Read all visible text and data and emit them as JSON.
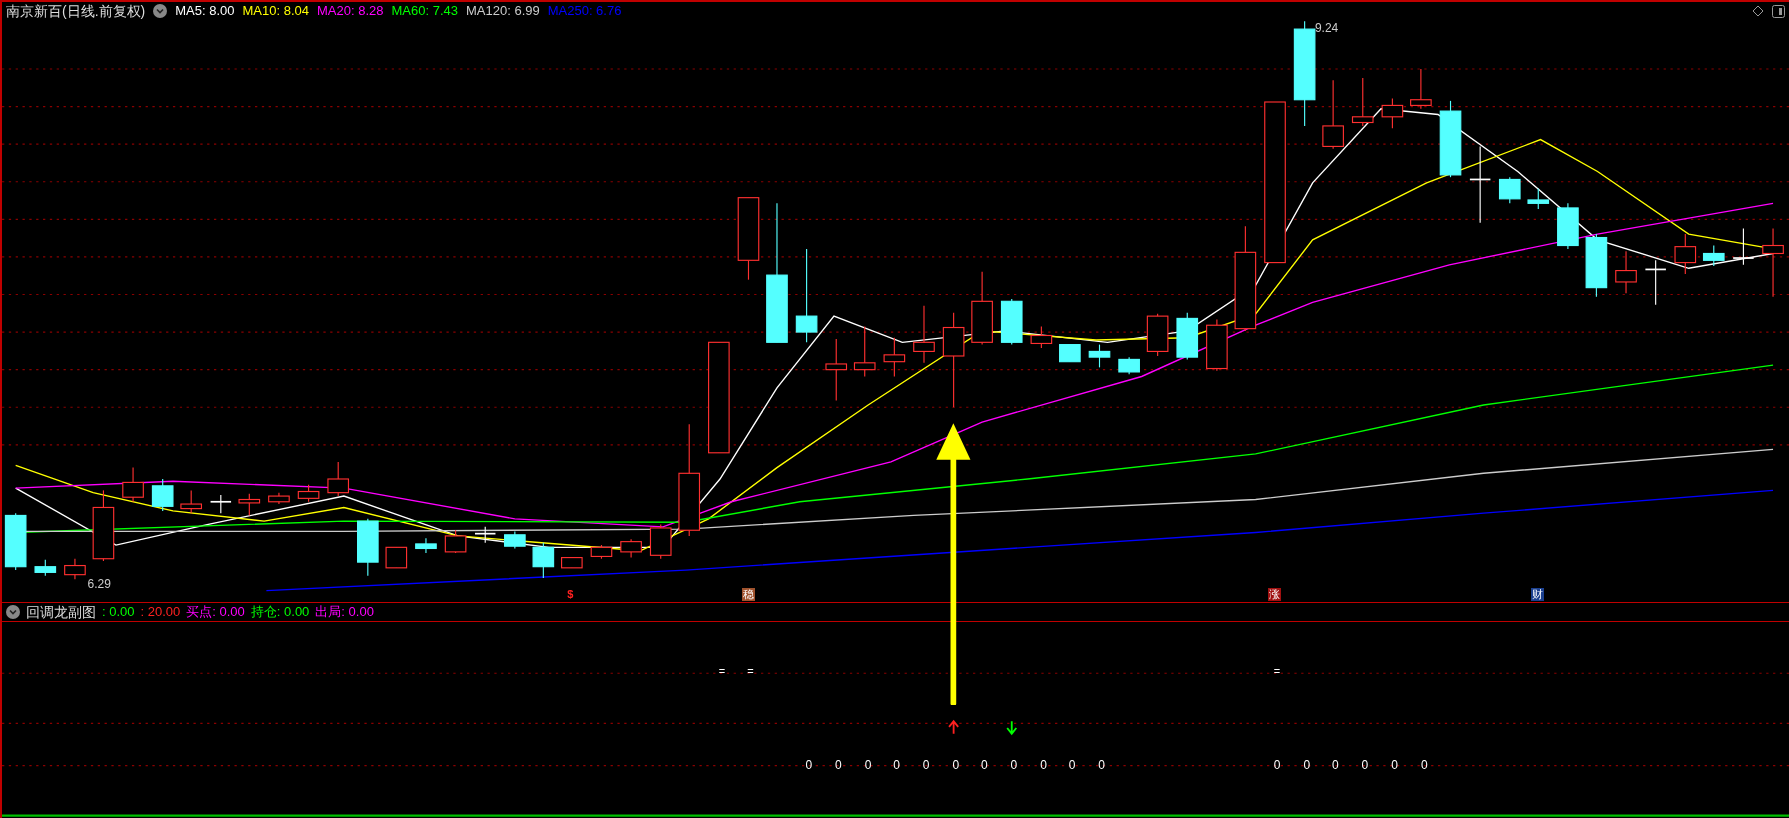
{
  "header": {
    "title": "南京新百(日线.前复权)",
    "indicators": [
      {
        "label": "MA5: 8.00",
        "color": "#ffffff"
      },
      {
        "label": "MA10: 8.04",
        "color": "#ffff00"
      },
      {
        "label": "MA20: 8.28",
        "color": "#ff00ff"
      },
      {
        "label": "MA60: 7.43",
        "color": "#00ff00"
      },
      {
        "label": "MA120: 6.99",
        "color": "#cccccc"
      },
      {
        "label": "MA250: 6.76",
        "color": "#0000ff"
      }
    ]
  },
  "main_chart": {
    "high_label": "9.24",
    "low_label": "6.29",
    "signals": [
      {
        "text": "$",
        "kind": "text",
        "color": "#ff2020"
      },
      {
        "text": "稳",
        "kind": "badge",
        "color": "#a0522d"
      },
      {
        "text": "涨",
        "kind": "badge",
        "color": "#a01010"
      },
      {
        "text": "财",
        "kind": "badge",
        "color": "#1a3f8f"
      }
    ]
  },
  "sub_chart": {
    "title": "回调龙副图",
    "values": [
      {
        "label": ": 0.00",
        "color": "#00ff00"
      },
      {
        "label": ": 20.00",
        "color": "#ff2020"
      },
      {
        "label": "买点: 0.00",
        "color": "#ff00ff"
      },
      {
        "label": "持仓: 0.00",
        "color": "#00ff00"
      },
      {
        "label": "出局: 0.00",
        "color": "#ff00ff"
      }
    ],
    "equals_marks": [
      "=",
      "=",
      "="
    ],
    "zeros": [
      "0",
      "0",
      "0",
      "0",
      "0",
      "0",
      "0",
      "0",
      "0",
      "0",
      "0",
      "0",
      "0",
      "0",
      "0",
      "0",
      "0"
    ]
  }
}
